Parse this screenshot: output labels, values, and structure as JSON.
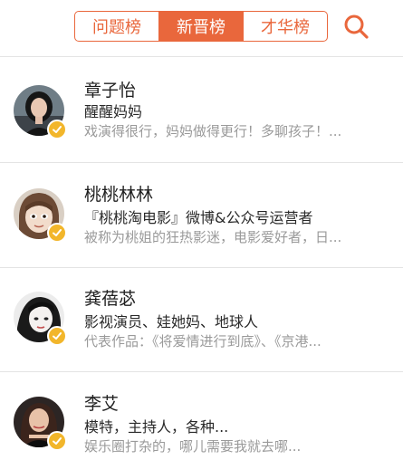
{
  "header": {
    "tabs": [
      {
        "label": "问题榜",
        "active": false
      },
      {
        "label": "新晋榜",
        "active": true
      },
      {
        "label": "才华榜",
        "active": false
      }
    ],
    "search_icon": "search-icon",
    "accent_color": "#e9673c"
  },
  "list": [
    {
      "name": "章子怡",
      "title": "醒醒妈妈",
      "desc": "戏演得很行，妈妈做得更行！多聊孩子！...",
      "verified": true
    },
    {
      "name": "桃桃林林",
      "title": "『桃桃淘电影』微博&公众号运营者",
      "desc": "被称为桃姐的狂热影迷，电影爱好者，日...",
      "verified": true
    },
    {
      "name": "龚蓓苾",
      "title": "影视演员、娃她妈、地球人",
      "desc": "代表作品：《将爱情进行到底》、《京港...",
      "verified": true
    },
    {
      "name": "李艾",
      "title": "模特，主持人，各种...",
      "desc": "娱乐圈打杂的，哪儿需要我就去哪...",
      "verified": true
    }
  ]
}
